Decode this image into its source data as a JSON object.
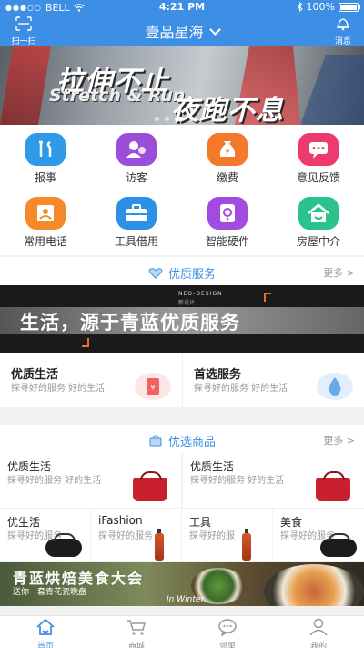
{
  "status": {
    "carrier": "BELL",
    "time": "4:21 PM",
    "battery": "100%"
  },
  "nav": {
    "scan_label": "扫一扫",
    "title": "壹品星海",
    "message_label": "消息"
  },
  "banner": {
    "line1": "拉伸不止",
    "line2": "Stretch & Run",
    "line3": "夜跑不息"
  },
  "grid": [
    {
      "label": "报事",
      "icon": "wrench-icon",
      "color": "#2f9be8"
    },
    {
      "label": "访客",
      "icon": "visitor-icon",
      "color": "#9b4fd8"
    },
    {
      "label": "缴费",
      "icon": "money-bag-icon",
      "color": "#f5792a"
    },
    {
      "label": "意见反馈",
      "icon": "chat-icon",
      "color": "#ee3b6e"
    },
    {
      "label": "常用电话",
      "icon": "phone-book-icon",
      "color": "#f58a2a"
    },
    {
      "label": "工具借用",
      "icon": "toolbox-icon",
      "color": "#2e8fe6"
    },
    {
      "label": "智能硬件",
      "icon": "device-icon",
      "color": "#a24be0"
    },
    {
      "label": "房屋中介",
      "icon": "house-icon",
      "color": "#2cc28c"
    }
  ],
  "quality": {
    "title": "优质服务",
    "more": "更多 >",
    "banner_brand": "NEO-DESIGN",
    "banner_brand_sub": "新设计",
    "banner_slogan": "生活，源于青蓝优质服务",
    "cards": [
      {
        "name": "优质生活",
        "sub": "探寻好的服务 好的生活"
      },
      {
        "name": "首选服务",
        "sub": "探寻好的服务 好的生活"
      }
    ]
  },
  "goods": {
    "title": "优选商品",
    "more": "更多 >",
    "big": [
      {
        "name": "优质生活",
        "sub": "探寻好的服务 好的生活"
      },
      {
        "name": "优质生活",
        "sub": "探寻好的服务 好的生活"
      }
    ],
    "small": [
      {
        "name": "优生活",
        "sub": "探寻好的服务"
      },
      {
        "name": "iFashion",
        "sub": "探寻好的服务"
      },
      {
        "name": "工具",
        "sub": "探寻好的服"
      },
      {
        "name": "美食",
        "sub": "探寻好的服务"
      }
    ]
  },
  "food_banner": {
    "title": "青蓝烘焙美食大会",
    "sub": "送你一套青花瓷晚盘",
    "season": "In Winter"
  },
  "tabs": [
    "首页",
    "商城",
    "邻里",
    "我的"
  ],
  "colors": {
    "primary": "#3d8fe6"
  }
}
